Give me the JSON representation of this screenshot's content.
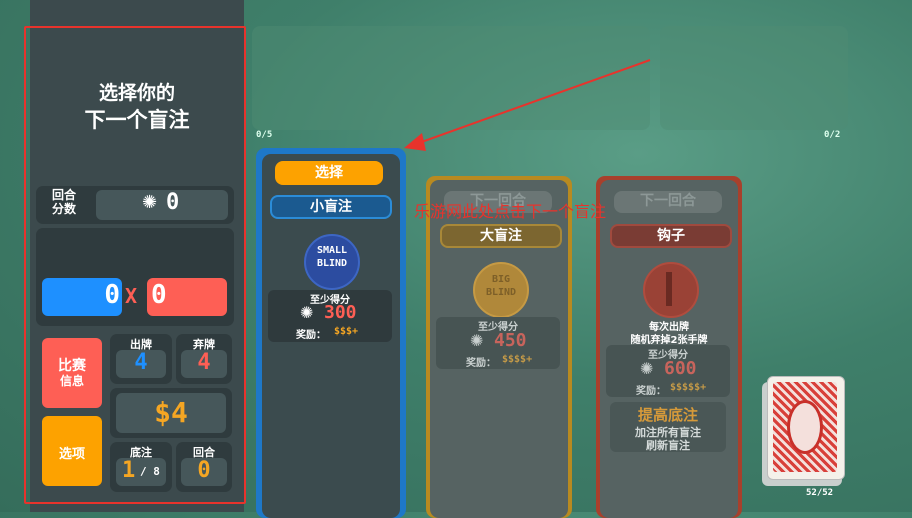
{
  "header": {
    "title_line1": "选择你的",
    "title_line2": "下一个盲注"
  },
  "round_score": {
    "label_line1": "回合",
    "label_line2": "分数",
    "icon": "chip-icon",
    "value": "0"
  },
  "hand_score": {
    "chips": "0",
    "x": "X",
    "mult": "0"
  },
  "buttons": {
    "run_info_line1": "比赛",
    "run_info_line2": "信息",
    "options": "选项"
  },
  "stats": {
    "hands_label": "出牌",
    "hands": "4",
    "discards_label": "弃牌",
    "discards": "4",
    "money": "$4",
    "ante_label": "底注",
    "ante": "1",
    "ante_max": "/ 8",
    "round_label": "回合",
    "round": "0"
  },
  "counters": {
    "left": "0/5",
    "right": "0/2"
  },
  "annotation": {
    "text": "此处点击下一个盲注"
  },
  "annotation_prefix": "乐游网",
  "blinds": [
    {
      "top_label": "选择",
      "name": "小盲注",
      "chip_text_1": "SMALL",
      "chip_text_2": "BLIND",
      "req_label": "至少得分",
      "req_value": "300",
      "reward_label": "奖励：",
      "reward": "$$$+"
    },
    {
      "top_label": "下一回合",
      "name": "大盲注",
      "chip_text_1": "BIG",
      "chip_text_2": "BLIND",
      "req_label": "至少得分",
      "req_value": "450",
      "reward_label": "奖励：",
      "reward": "$$$$+"
    },
    {
      "top_label": "下一回合",
      "name": "钩子",
      "desc_line1": "每次出牌",
      "desc_line2": "随机弃掉2张手牌",
      "req_label": "至少得分",
      "req_value": "600",
      "reward_label": "奖励：",
      "reward": "$$$$$+",
      "raise_title": "提高底注",
      "raise_line1": "加注所有盲注",
      "raise_line2": "刷新盲注"
    }
  ],
  "deck": {
    "count": "52/52"
  },
  "colors": {
    "blue": "#1e90ff",
    "red": "#fe5f55",
    "orange": "#fda200",
    "gold": "#f5a623",
    "annotation": "#e8332c"
  }
}
